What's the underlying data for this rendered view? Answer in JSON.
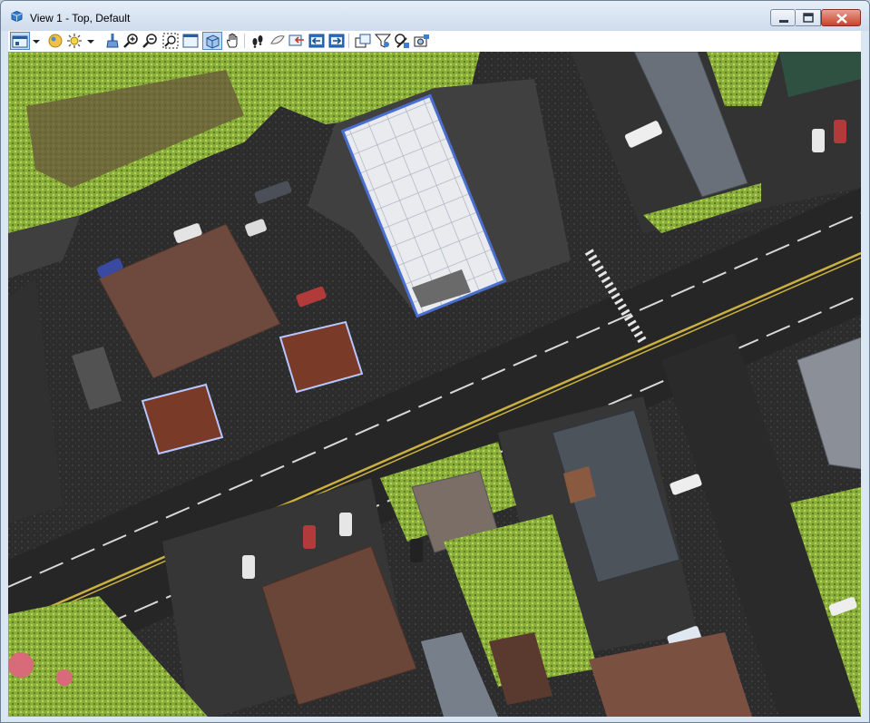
{
  "window": {
    "title": "View 1 - Top, Default"
  },
  "colors": {
    "titlebar": "#dbe6f3",
    "close": "#c7442c",
    "asphalt": "#2a2a2a",
    "roof_brown": "#6e4a3e",
    "canopy": "#e8eaee",
    "vegetation": "#8fb33a"
  },
  "toolbar": {
    "buttons": [
      {
        "name": "view-attributes-icon",
        "active": true
      },
      {
        "name": "dropdown-arrow-icon"
      },
      {
        "name": "display-style-icon"
      },
      {
        "name": "lighting-icon"
      },
      {
        "name": "dropdown-arrow-icon"
      },
      {
        "name": "clip-volume-icon"
      },
      {
        "name": "zoom-in-icon"
      },
      {
        "name": "zoom-out-icon"
      },
      {
        "name": "window-area-icon"
      },
      {
        "name": "fit-view-icon"
      },
      {
        "name": "rotate-view-icon",
        "active": true
      },
      {
        "name": "pan-view-icon"
      },
      {
        "name": "walk-icon"
      },
      {
        "name": "fly-icon"
      },
      {
        "name": "view-previous-icon"
      },
      {
        "name": "view-next-icon"
      },
      {
        "name": "copy-view-icon"
      },
      {
        "name": "clip-filter-icon"
      },
      {
        "name": "clip-mask-icon"
      },
      {
        "name": "camera-icon"
      }
    ]
  }
}
